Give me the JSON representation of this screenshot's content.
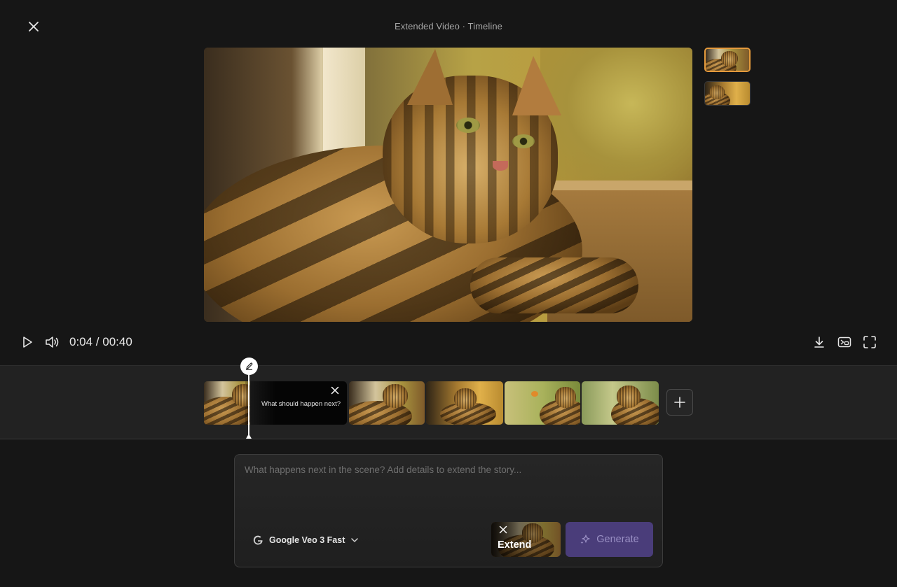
{
  "header": {
    "title": "Extended Video · Timeline"
  },
  "player": {
    "time": "0:04 / 00:40"
  },
  "timeline": {
    "prompt_text": "What should happen next?"
  },
  "prompt": {
    "placeholder": "What happens next in the scene? Add details to extend the story...",
    "model_label": "Google Veo 3 Fast",
    "extend_label": "Extend",
    "generate_label": "Generate"
  },
  "colors": {
    "accent": "#e59a3c",
    "generate_bg": "#4a3d7a",
    "background": "#161616"
  }
}
